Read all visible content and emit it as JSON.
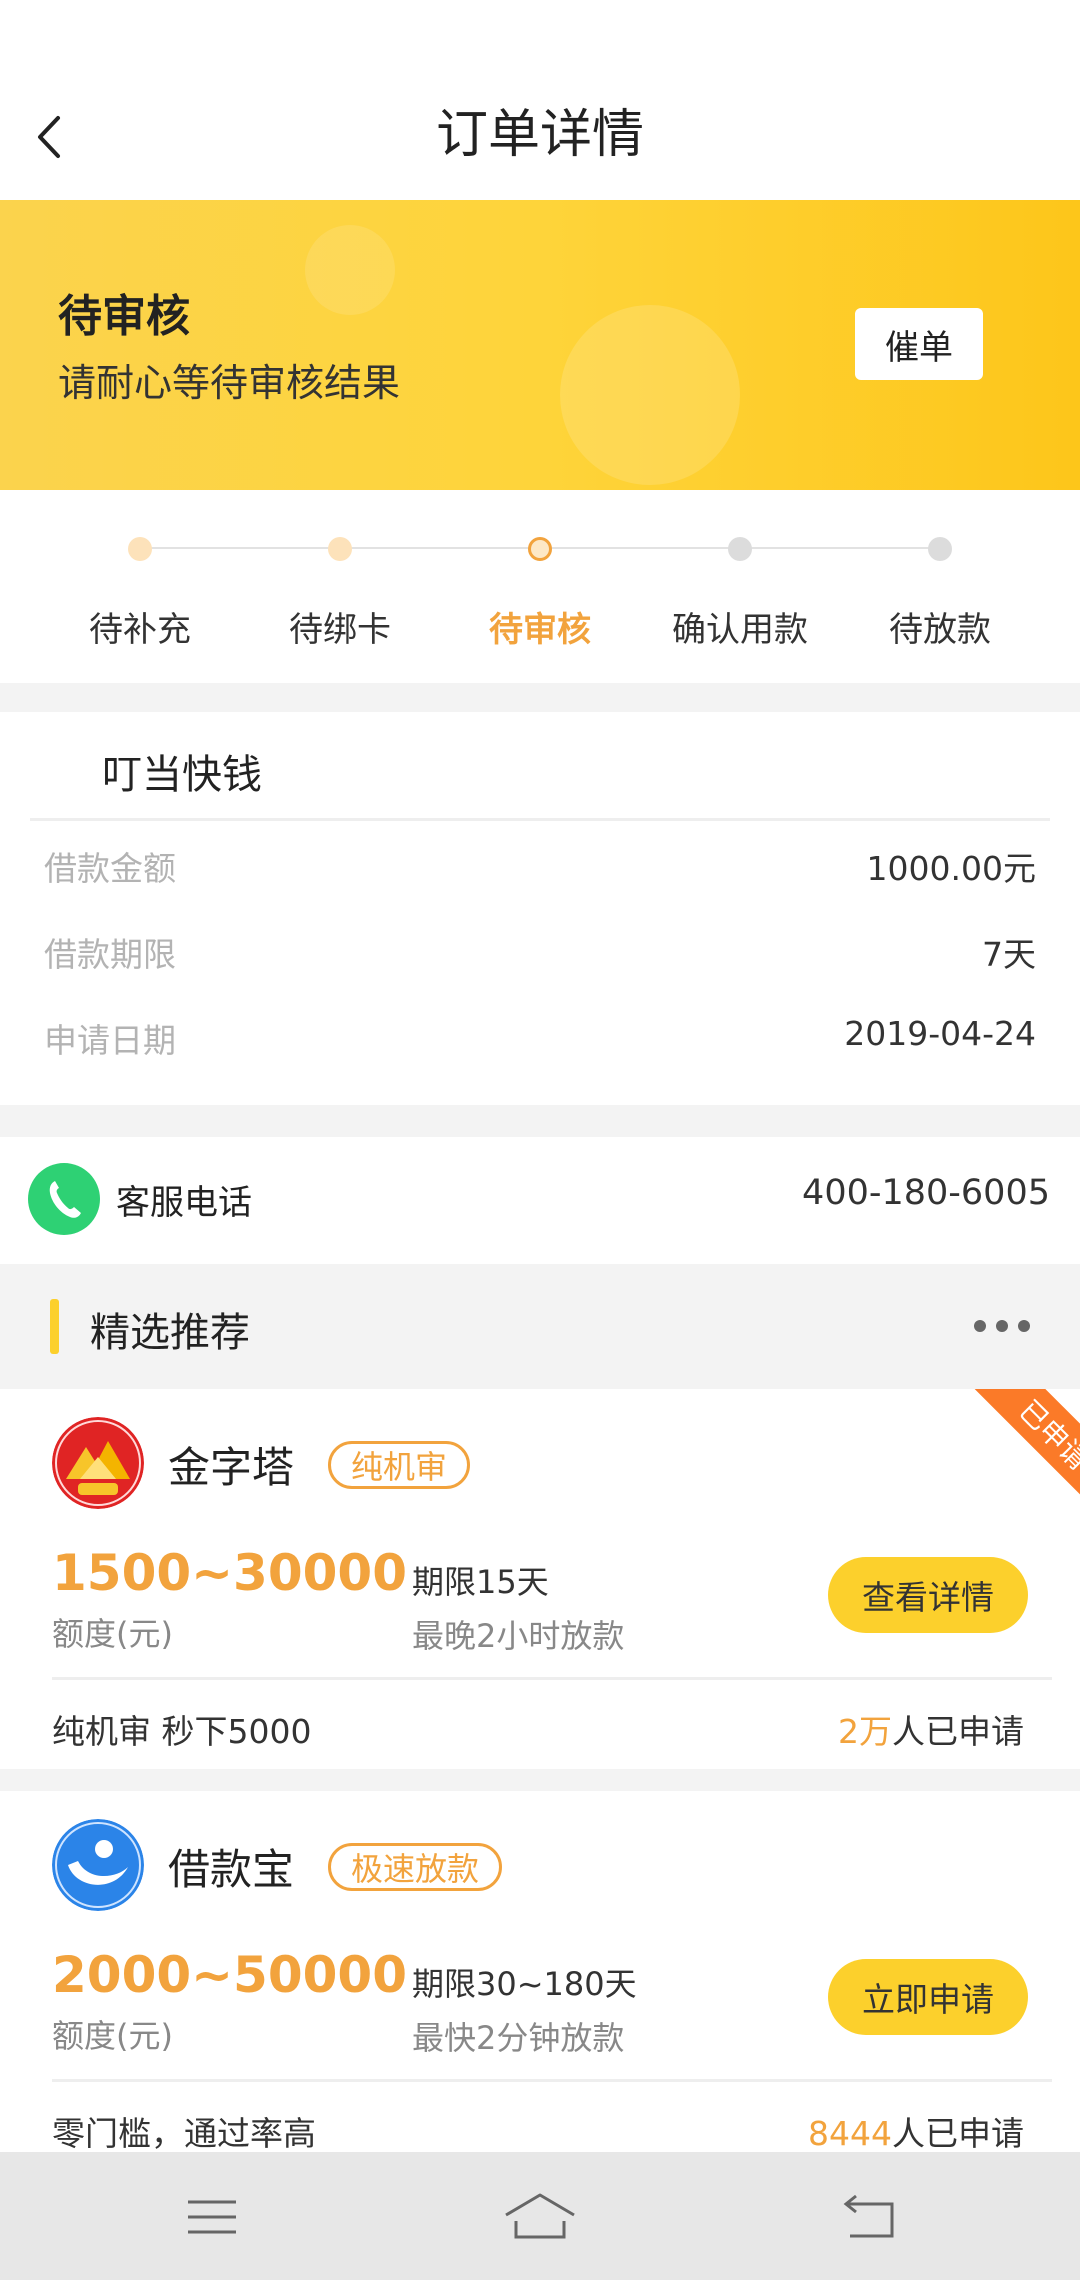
{
  "header": {
    "title": "订单详情"
  },
  "status": {
    "title": "待审核",
    "subtitle": "请耐心等待审核结果",
    "urge_label": "催单"
  },
  "steps": [
    {
      "label": "待补充",
      "state": "done"
    },
    {
      "label": "待绑卡",
      "state": "done"
    },
    {
      "label": "待审核",
      "state": "active"
    },
    {
      "label": "确认用款",
      "state": "todo"
    },
    {
      "label": "待放款",
      "state": "todo"
    }
  ],
  "loan": {
    "product_name": "叮当快钱",
    "rows": [
      {
        "label": "借款金额",
        "value": "1000.00元"
      },
      {
        "label": "借款期限",
        "value": "7天"
      },
      {
        "label": "申请日期",
        "value": "2019-04-24"
      }
    ]
  },
  "service": {
    "label": "客服电话",
    "phone": "400-180-6005"
  },
  "recommend": {
    "title": "精选推荐",
    "products": [
      {
        "name": "金字塔",
        "tag": "纯机审",
        "amount": "1500~30000",
        "amount_label": "额度(元)",
        "term": "期限15天",
        "speed": "最晚2小时放款",
        "button": "查看详情",
        "desc": "纯机审 秒下5000",
        "count_num": "2万",
        "count_suffix": "人已申请",
        "ribbon": "已申请"
      },
      {
        "name": "借款宝",
        "tag": "极速放款",
        "amount": "2000~50000",
        "amount_label": "额度(元)",
        "term": "期限30~180天",
        "speed": "最快2分钟放款",
        "button": "立即申请",
        "desc": "零门槛，通过率高",
        "count_num": "8444",
        "count_suffix": "人已申请"
      }
    ]
  },
  "colors": {
    "accent": "#f2a33d",
    "brand_yellow": "#fcd02c",
    "ribbon": "#fb7a28",
    "phone_green": "#2ed174"
  }
}
